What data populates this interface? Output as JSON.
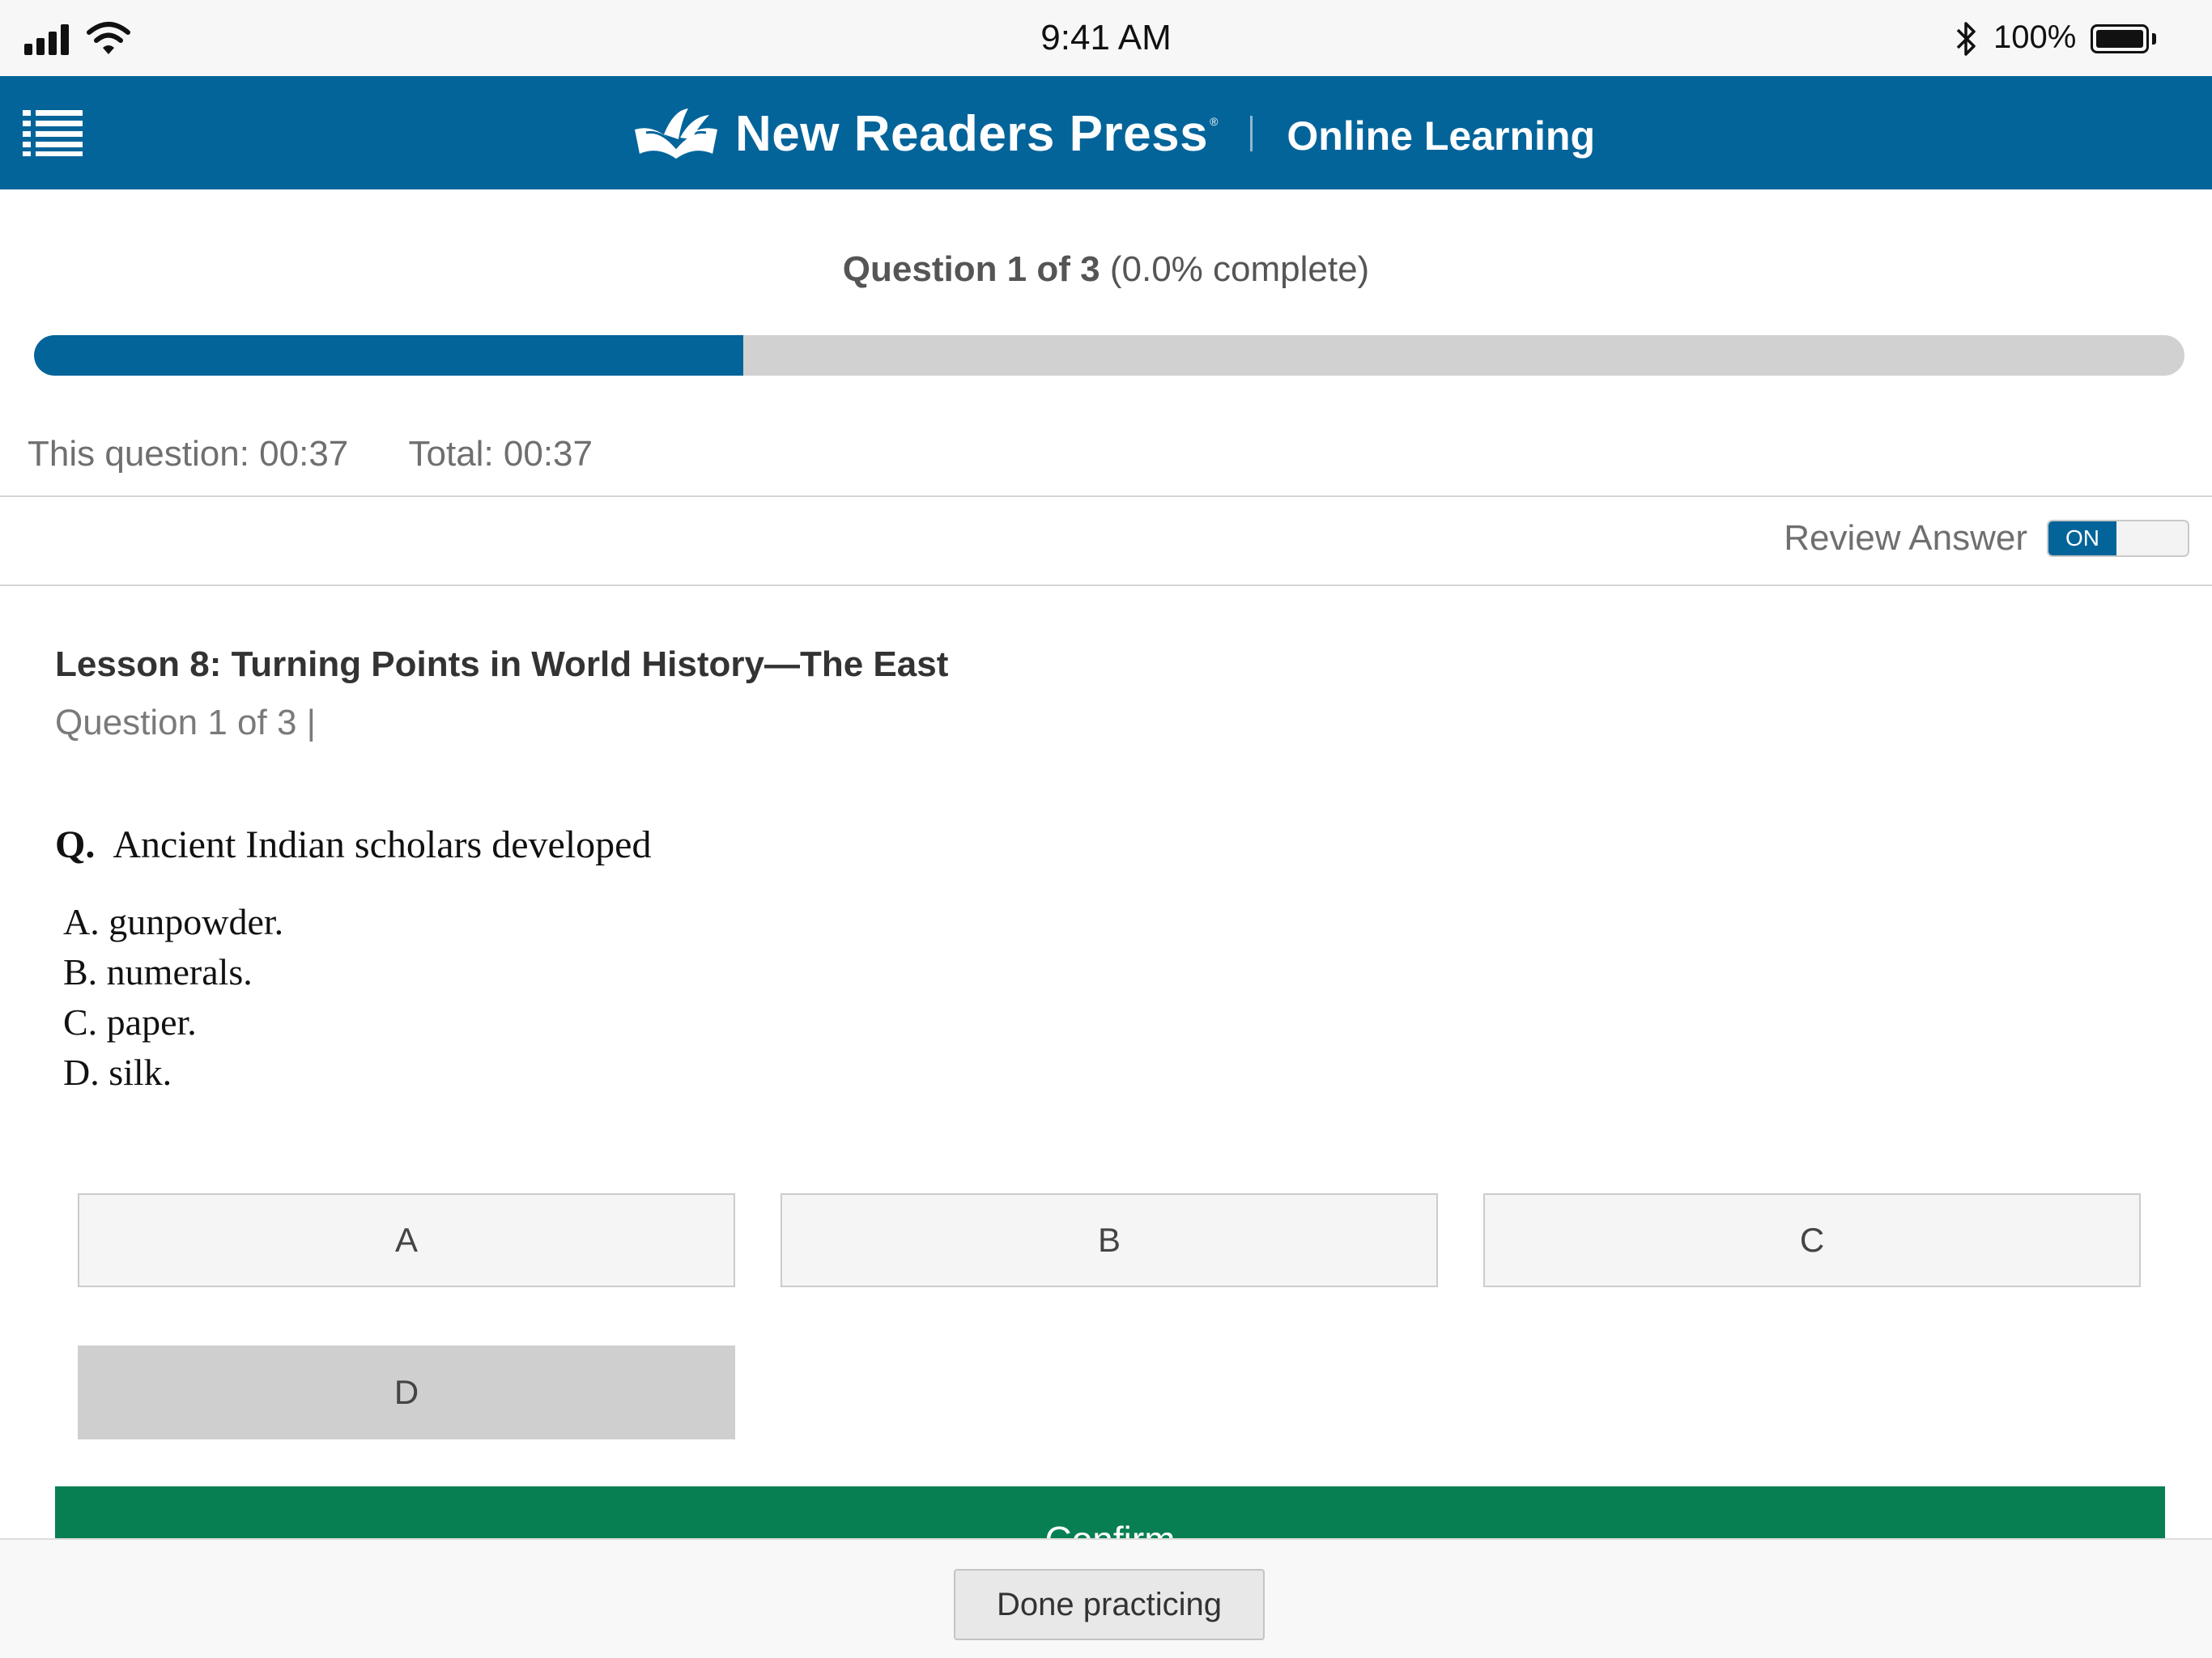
{
  "status_bar": {
    "time": "9:41 AM",
    "battery_percent": "100%",
    "icons": [
      "signal-icon",
      "wifi-icon",
      "bluetooth-icon",
      "battery-icon"
    ]
  },
  "header": {
    "brand_name": "New Readers Press",
    "brand_reg": "®",
    "brand_sub": "Online Learning",
    "background_color": "#03649a",
    "menu_icon": "list-menu-icon"
  },
  "progress": {
    "question_label": "Question 1 of 3",
    "percent_label": "(0.0% complete)",
    "fill_fraction": 0.33,
    "fill_color": "#03649a",
    "track_color": "#d1d1d1"
  },
  "timers": {
    "this_question": "This question: 00:37",
    "total": "Total: 00:37"
  },
  "review": {
    "label": "Review Answer",
    "toggle_state": "ON"
  },
  "lesson": {
    "title": "Lesson 8: Turning Points in World History—The East",
    "subtitle": "Question 1 of 3 |"
  },
  "question": {
    "prefix": "Q.",
    "text": "Ancient Indian scholars developed",
    "options": [
      "A. gunpowder.",
      "B. numerals.",
      "C. paper.",
      "D. silk."
    ]
  },
  "answers": {
    "buttons": [
      "A",
      "B",
      "C",
      "D"
    ],
    "selected": "D"
  },
  "confirm": {
    "label": "Confirm",
    "color": "#087f52"
  },
  "footer": {
    "done_label": "Done practicing"
  }
}
